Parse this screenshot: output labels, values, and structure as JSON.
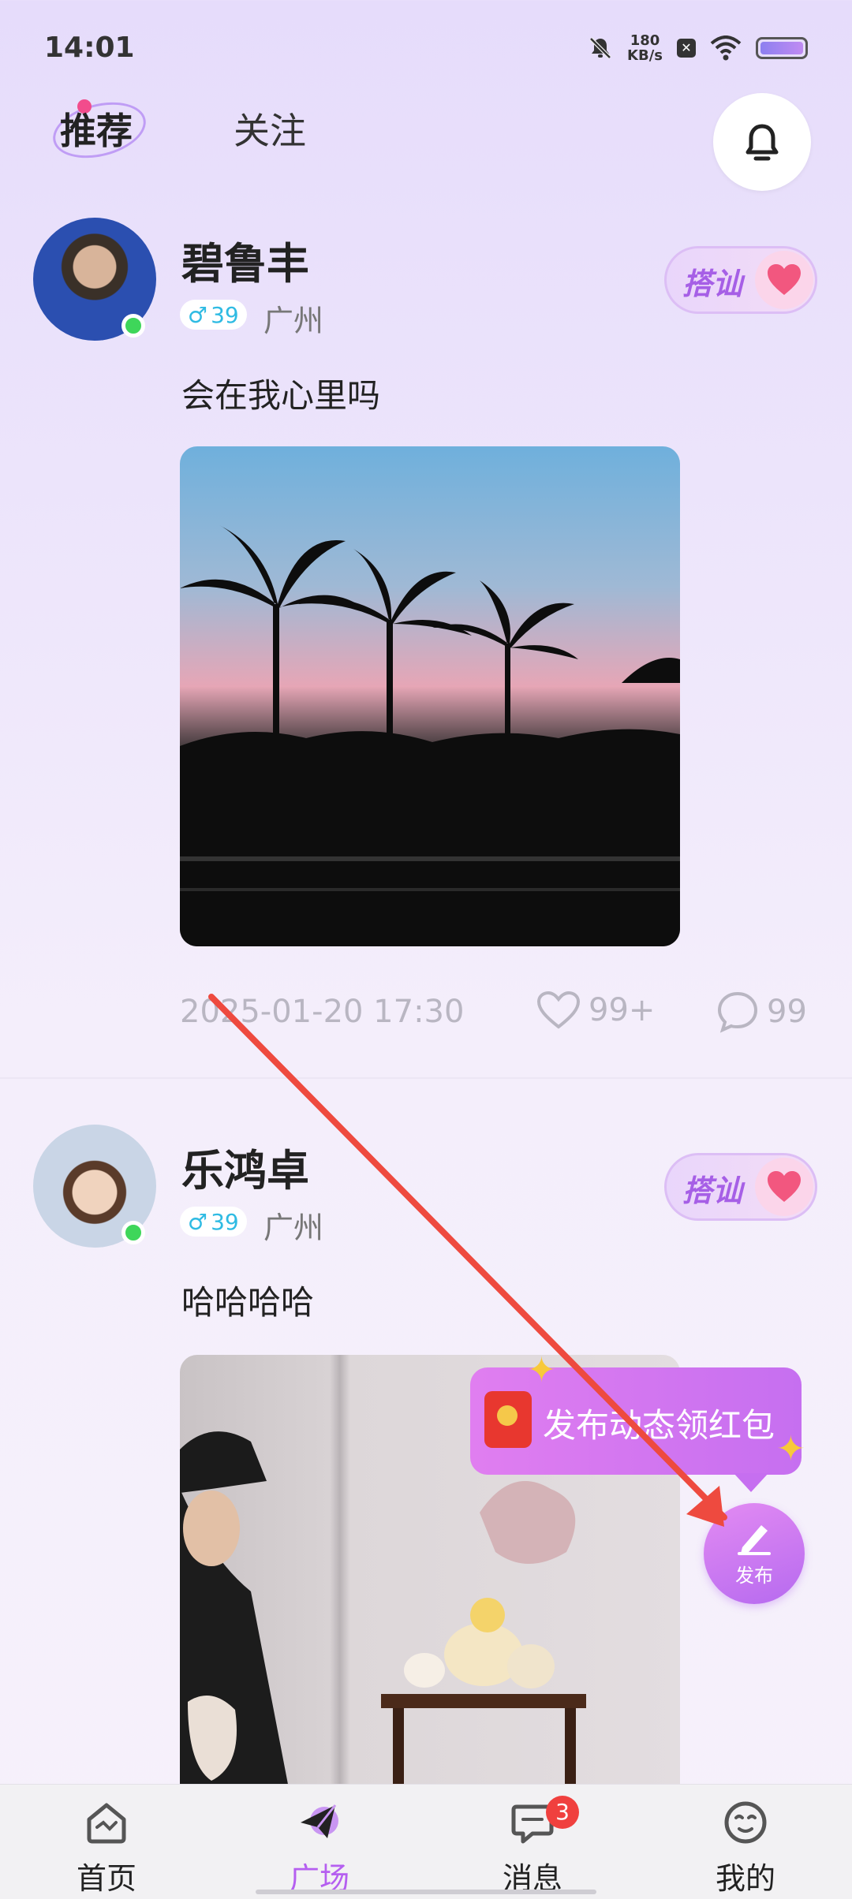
{
  "status_bar": {
    "time": "14:01",
    "net_speed_value": "180",
    "net_speed_unit": "KB/s"
  },
  "header": {
    "tabs": [
      {
        "label": "推荐",
        "active": true
      },
      {
        "label": "关注",
        "active": false
      }
    ]
  },
  "posts": [
    {
      "name": "碧鲁丰",
      "gender_symbol": "♂",
      "age": "39",
      "city": "广州",
      "content": "会在我心里吗",
      "timestamp": "2025-01-20 17:30",
      "likes": "99+",
      "comments": "99",
      "flirt_label": "搭讪"
    },
    {
      "name": "乐鸿卓",
      "gender_symbol": "♂",
      "age": "39",
      "city": "广州",
      "content": "哈哈哈哈",
      "flirt_label": "搭讪"
    }
  ],
  "promo": {
    "text": "发布动态领红包"
  },
  "publish_button": {
    "label": "发布"
  },
  "bottom_nav": {
    "items": [
      {
        "label": "首页",
        "icon": "home-icon"
      },
      {
        "label": "广场",
        "icon": "plaza-icon",
        "active": true
      },
      {
        "label": "消息",
        "icon": "message-icon",
        "badge": "3"
      },
      {
        "label": "我的",
        "icon": "profile-icon"
      }
    ]
  },
  "colors": {
    "accent": "#b55ff0",
    "badge": "#f0403e",
    "online": "#3ed65a",
    "age_badge": "#2fbbe3"
  }
}
